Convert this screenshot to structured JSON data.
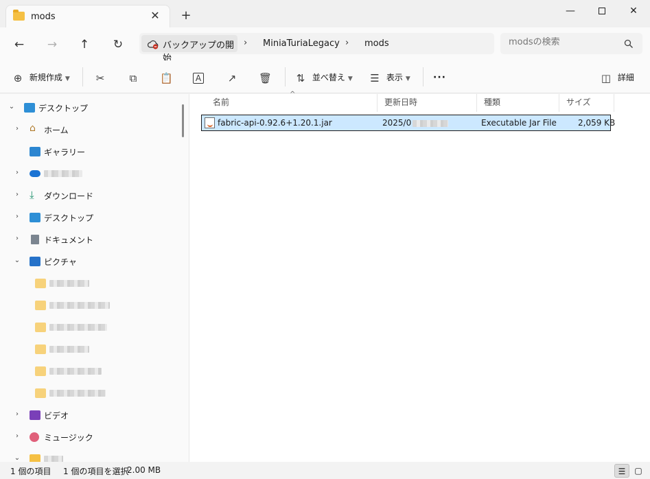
{
  "window": {
    "tab_title": "mods",
    "tab_close": "✕",
    "new_tab": "+",
    "minimize": "—",
    "close": "✕"
  },
  "nav": {
    "back": "←",
    "forward": "→",
    "up": "↑",
    "refresh": "↻"
  },
  "address": {
    "backup_label": "バックアップの開始",
    "separator": "›",
    "crumbs": [
      "MiniaTuriaLegacy",
      "mods"
    ]
  },
  "search": {
    "placeholder": "modsの検索"
  },
  "toolbar": {
    "new_label": "新規作成",
    "sort_label": "並べ替え",
    "view_label": "表示",
    "more": "···",
    "details_label": "詳細"
  },
  "sidebar": {
    "desktop_root": "デスクトップ",
    "home": "ホーム",
    "gallery": "ギャラリー",
    "downloads": "ダウンロード",
    "desktop": "デスクトップ",
    "documents": "ドキュメント",
    "pictures": "ピクチャ",
    "videos": "ビデオ",
    "music": "ミュージック"
  },
  "columns": {
    "name": "名前",
    "modified": "更新日時",
    "type": "種類",
    "size": "サイズ"
  },
  "files": [
    {
      "name": "fabric-api-0.92.6+1.20.1.jar",
      "modified": "2025/0",
      "type": "Executable Jar File",
      "size": "2,059 KB"
    }
  ],
  "status": {
    "item_count": "1 個の項目",
    "selected": "1 個の項目を選択",
    "selected_size": "2.00 MB"
  },
  "colors": {
    "selection": "#cce8ff",
    "folder": "#f5c044",
    "accent": "#0067c0"
  }
}
